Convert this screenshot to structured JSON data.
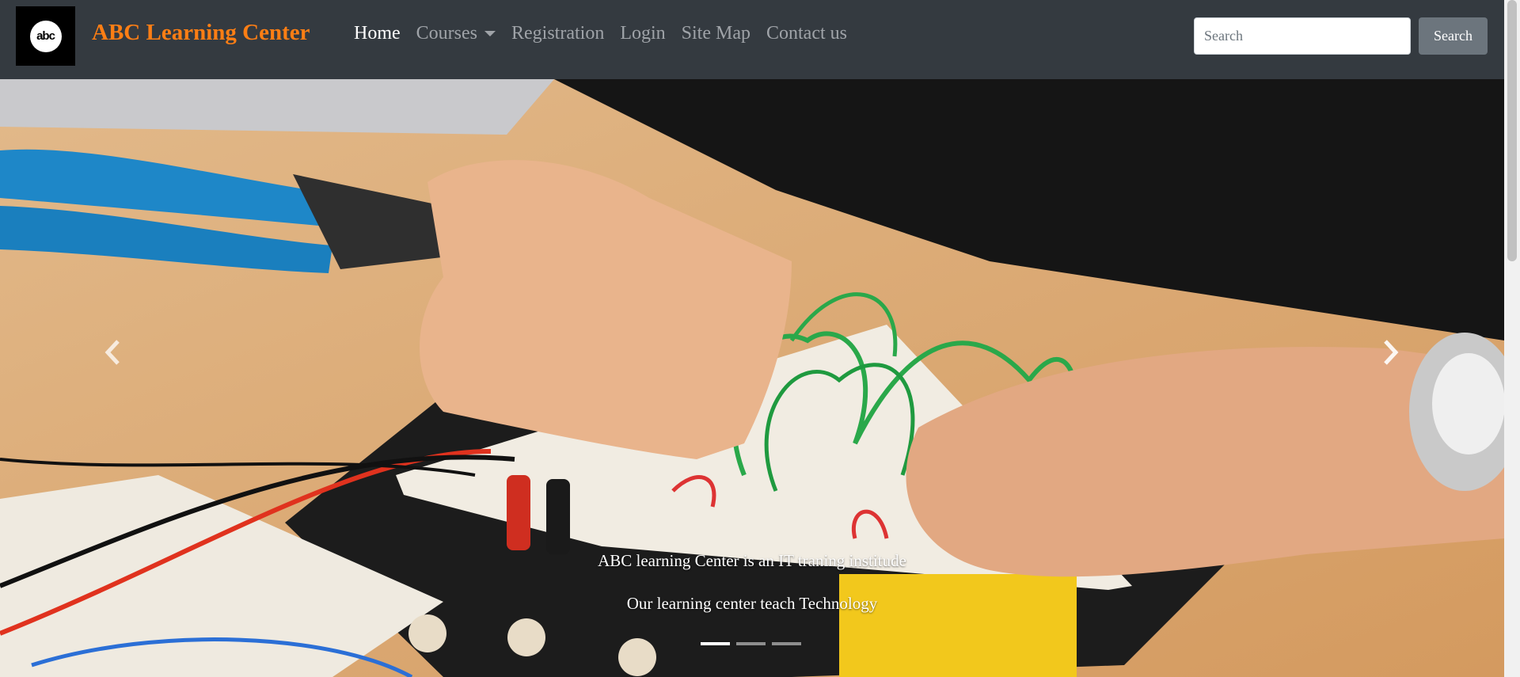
{
  "logo": {
    "text": "abc"
  },
  "brand": {
    "name": "ABC Learning Center",
    "color": "#fd7e14"
  },
  "nav": {
    "items": [
      {
        "label": "Home",
        "active": true
      },
      {
        "label": "Courses",
        "dropdown": true
      },
      {
        "label": "Registration"
      },
      {
        "label": "Login"
      },
      {
        "label": "Site Map"
      },
      {
        "label": "Contact us"
      }
    ]
  },
  "search": {
    "placeholder": "Search",
    "value": "",
    "button_label": "Search"
  },
  "carousel": {
    "image_description": "Hands wiring a breadboard with green, red and blue jumper wires",
    "caption_line1": "ABC learning Center is an IT traning institude",
    "caption_line2": "Our learning center teach Technology",
    "slide_count": 3,
    "active_slide": 1,
    "prev_icon": "chevron-left-icon",
    "next_icon": "chevron-right-icon"
  },
  "colors": {
    "navbar": "#343a40",
    "search_button": "#6c757d"
  }
}
